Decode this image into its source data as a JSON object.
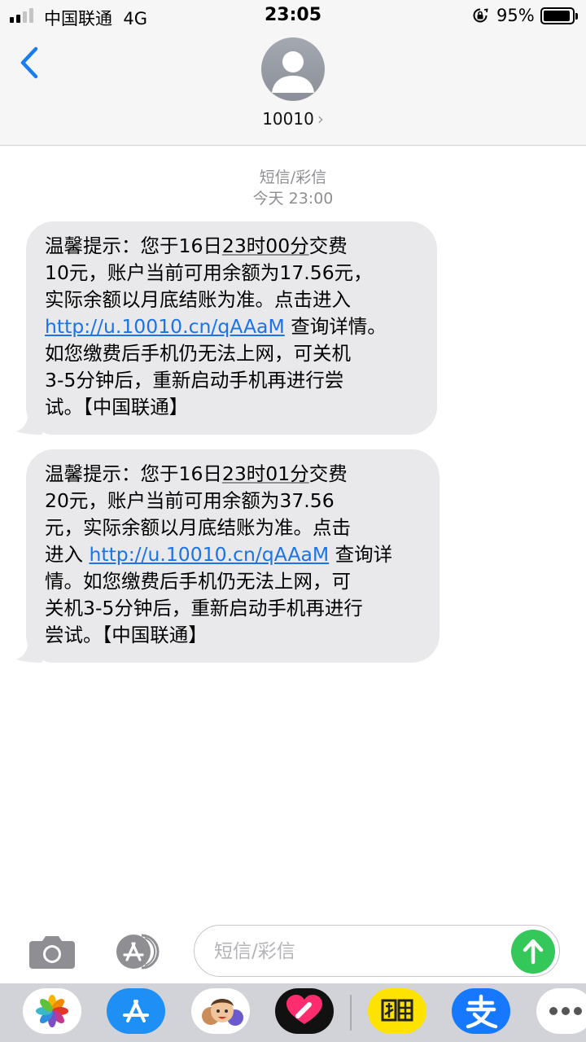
{
  "status_bar": {
    "carrier": "中国联通",
    "network": "4G",
    "time": "23:05",
    "battery_percent": "95%",
    "battery_level": 0.95,
    "signal_bars": 2
  },
  "header": {
    "back_icon": "chevron-left-icon",
    "avatar_icon": "person-icon",
    "contact": "10010",
    "contact_chevron": "›"
  },
  "conversation": {
    "message_type": "短信/彩信",
    "timestamp": "今天 23:00"
  },
  "messages": [
    {
      "l1a": "温馨提示：您于16日",
      "l1u": "23时00分",
      "l1b": "交费",
      "l2": "10元，账户当前可用余额为17.56元，",
      "l3": "实际余额以月底结账为准。点击进入",
      "link": "http://u.10010.cn/qAAaM",
      "l4b": " 查询详情。",
      "l5": "如您缴费后手机仍无法上网，可关机",
      "l6": "3-5分钟后，重新启动手机再进行尝",
      "l7": "试。【中国联通】"
    },
    {
      "l1a": "温馨提示：您于16日",
      "l1u": "23时01分",
      "l1b": "交费",
      "l2": "20元，账户当前可用余额为37.56",
      "l3": "元，实际余额以月底结账为准。点击",
      "l4a": "进入 ",
      "link": "http://u.10010.cn/qAAaM",
      "l4b": " 查询详",
      "l5": "情。如您缴费后手机仍无法上网，可",
      "l6": "关机3-5分钟后，重新启动手机再进行",
      "l7": "尝试。【中国联通】"
    }
  ],
  "input": {
    "placeholder": "短信/彩信"
  },
  "colors": {
    "link": "#1a73e8",
    "bubble": "#e9e9eb",
    "send": "#34c759",
    "back": "#1a7cf5"
  },
  "dock_apps": [
    "photos-icon",
    "app-store-icon",
    "memoji-icon",
    "digital-touch-icon",
    "xianyu-icon",
    "alipay-icon",
    "more-icon"
  ]
}
